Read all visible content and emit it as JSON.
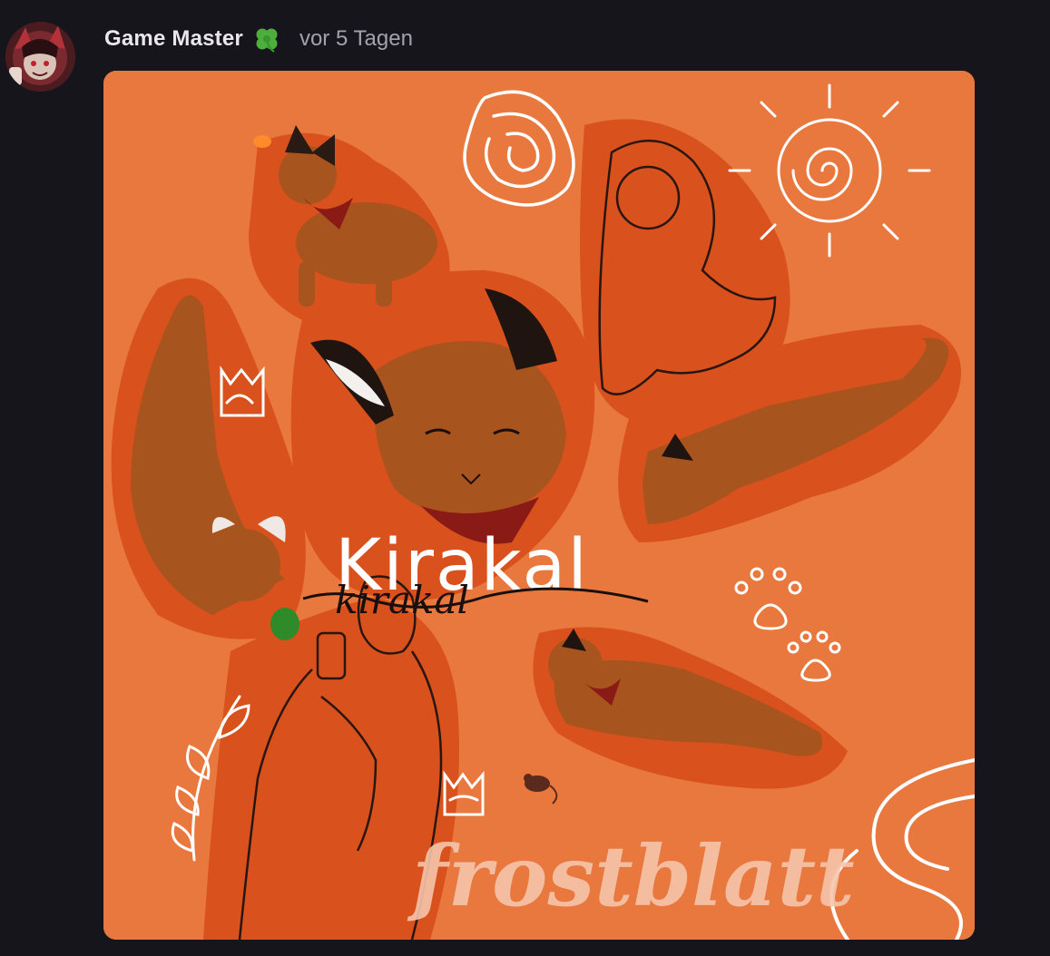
{
  "post": {
    "author": "Game Master",
    "author_badge_icon": "four-leaf-clover-icon",
    "timestamp": "vor 5 Tagen",
    "avatar_icon": "user-avatar",
    "image": {
      "title_main": "Kirakal",
      "title_script": "kirakal",
      "signature": "frostblatt",
      "background_color": "#e9783f",
      "highlight_color": "#d9511d"
    }
  }
}
